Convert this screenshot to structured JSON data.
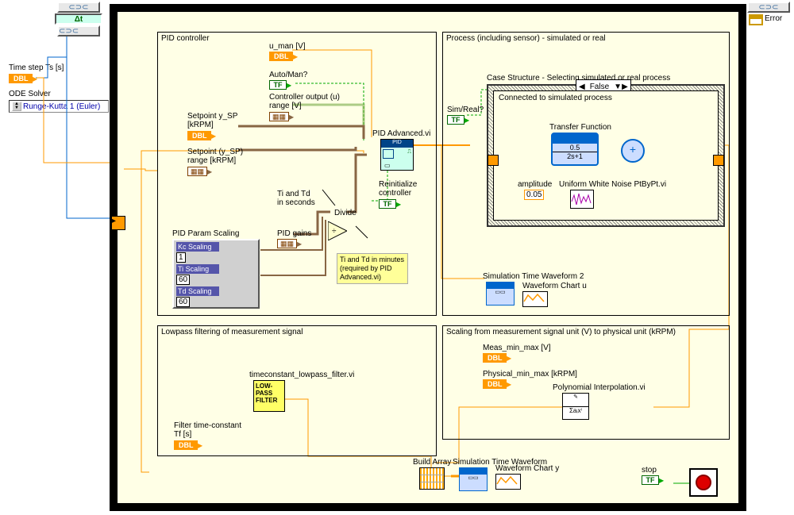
{
  "left_panel": {
    "time_step_label": "Time step Ts [s]",
    "dbl": "DBL",
    "ode_solver_label": "ODE Solver",
    "ode_solver_value": "Runge-Kutta 1 (Euler)",
    "error_label": "Error",
    "dt_glyph": "Δt"
  },
  "pid": {
    "title": "PID controller",
    "u_man": "u_man [V]",
    "auto_man": "Auto/Man?",
    "ctrl_out": "Controller output (u)\nrange [V]",
    "setpoint_sp": "Setpoint y_SP\n[kRPM]",
    "setpoint_range": "Setpoint (y_SP)\nrange [kRPM]",
    "vi": "PID Advanced.vi",
    "pid_gains": "PID gains",
    "scaling_title": "PID Param Scaling",
    "kc": "Kc Scaling",
    "kc_v": "1",
    "ti": "Ti Scaling",
    "ti_v": "60",
    "td": "Td Scaling",
    "td_v": "60",
    "ti_td_sec": "Ti and Td\nin seconds",
    "divide": "Divide",
    "reinit": "Reinitialize\ncontroller",
    "note": "Ti and Td\nin minutes\n(required by\nPID Advanced.vi)"
  },
  "process": {
    "title": "Process (including sensor) - simulated or real",
    "sim_real": "Sim/Real?",
    "case_title": "Case Structure - Selecting simulated or real process",
    "case_value": "False",
    "conn_label": "Connected to simulated process",
    "tf": "Transfer Function",
    "tf_num": "0.5",
    "tf_den": "2s+1",
    "amp_label": "amplitude",
    "amp_val": "0.05",
    "noise_vi": "Uniform White Noise PtByPt.vi",
    "sim_wave2": "Simulation Time Waveform 2",
    "chart_u": "Waveform Chart u"
  },
  "lowpass": {
    "title": "Lowpass filtering of measurement signal",
    "vi": "timeconstant_lowpass_filter.vi",
    "vi_text": "LOW-\nPASS\nFILTER",
    "tf_label": "Filter time-constant\nTf [s]"
  },
  "scaling": {
    "title": "Scaling from measurement signal unit (V) to physical unit (kRPM)",
    "meas": "Meas_min_max [V]",
    "phys": "Physical_min_max [kRPM]",
    "poly": "Polynomial Interpolation.vi",
    "sum": "Σaᵢxⁱ"
  },
  "bottom": {
    "build_array": "Build Array",
    "sim_wave": "Simulation Time Waveform",
    "chart_y": "Waveform Chart y",
    "stop": "stop"
  },
  "common": {
    "dbl": "DBL",
    "tf": "TF"
  }
}
